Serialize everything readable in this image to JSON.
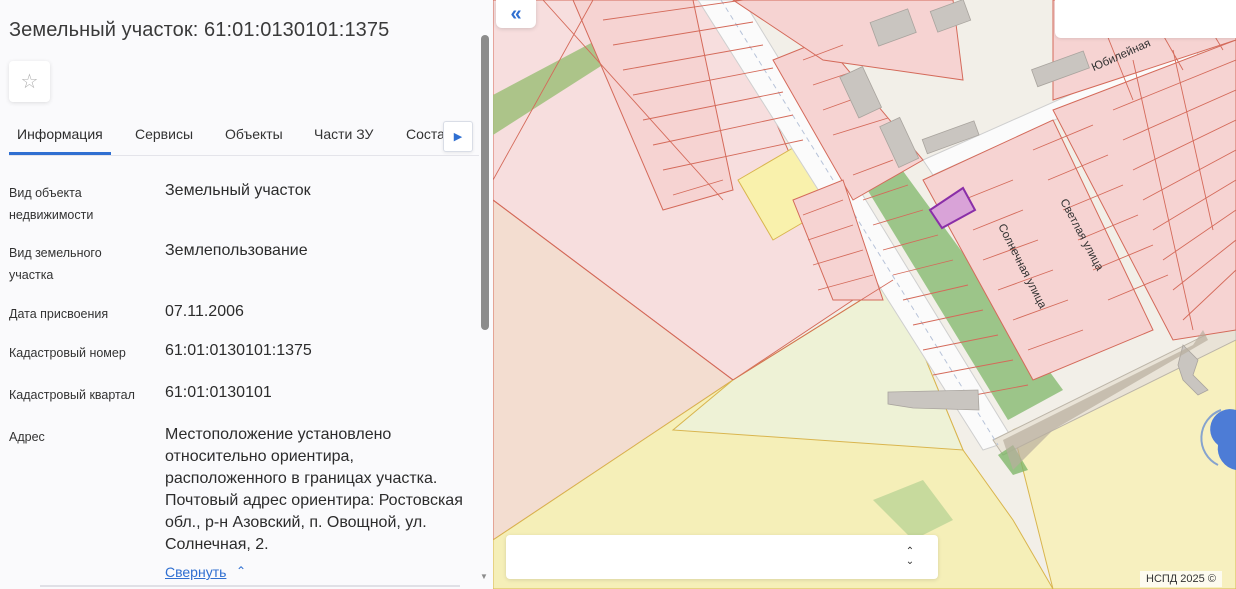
{
  "panel": {
    "title": "Земельный участок: 61:01:0130101:1375",
    "tabs": [
      {
        "label": "Информация"
      },
      {
        "label": "Сервисы"
      },
      {
        "label": "Объекты"
      },
      {
        "label": "Части ЗУ"
      },
      {
        "label": "Соста"
      }
    ],
    "properties": [
      {
        "label": "Вид объекта недвижимости",
        "value": "Земельный участок"
      },
      {
        "label": "Вид земельного участка",
        "value": "Землепользование"
      },
      {
        "label": "Дата присвоения",
        "value": "07.11.2006"
      },
      {
        "label": "Кадастровый номер",
        "value": "61:01:0130101:1375"
      },
      {
        "label": "Кадастровый квартал",
        "value": "61:01:0130101"
      },
      {
        "label": "Адрес",
        "value": "Местоположение установлено относительно ориентира, расположенного в границах участка. Почтовый адрес ориентира: Ростовская обл., р-н Азовский, п. Овощной, ул. Солнечная, 2."
      }
    ],
    "collapse_label": "Свернуть"
  },
  "map": {
    "streets": {
      "yubileinaya": "Юбилейная",
      "svetlaya": "Светлая улица",
      "solnechnaya": "Солнечная улица"
    },
    "attribution": "НСПД 2025 ©"
  },
  "icons": {
    "favorite": "star-outline-icon",
    "tab_scroll": "caret-right-icon",
    "collapse": "chevron-up-icon",
    "panel_collapse": "double-chevron-left-icon",
    "bar_toggle": "updown-chevron-icon"
  },
  "colors": {
    "accent": "#2f6fd1",
    "parcel_fill": "#f4d4d3",
    "parcel_stroke": "#d46a5a",
    "agri_fill": "#f5efb8",
    "green_strip": "#7fb76a",
    "selected_parcel": "#8a2fa8"
  }
}
